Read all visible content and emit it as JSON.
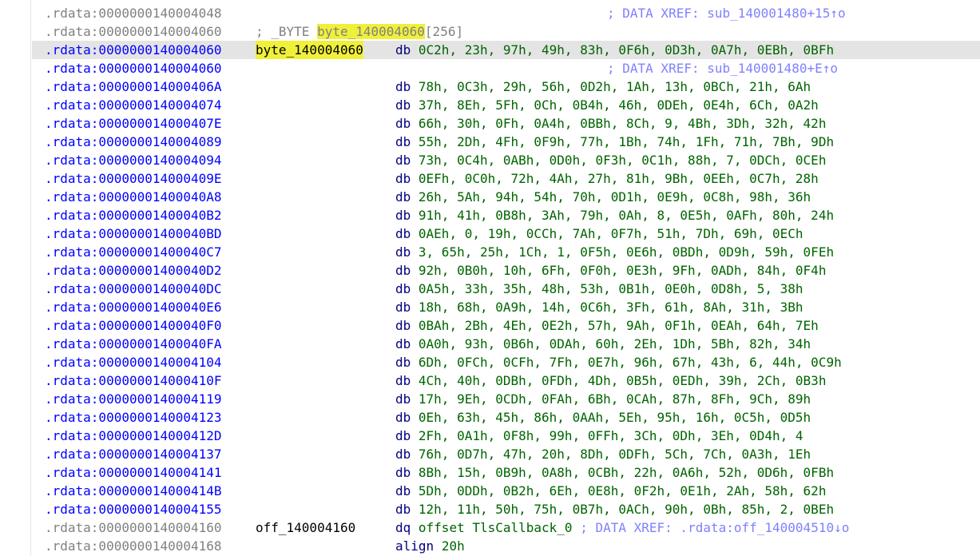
{
  "top": {
    "addr": ".rdata:0000000140004048",
    "comment": "; DATA XREF: sub_140001480+15↑o"
  },
  "declare": {
    "addr": ".rdata:0000000140004060",
    "prefix": "; _BYTE ",
    "name": "byte_140004060",
    "suffix": "[256]"
  },
  "selected": {
    "addr": ".rdata:0000000140004060",
    "label": "byte_140004060",
    "mnemonic": "db",
    "operands": "0C2h, 23h, 97h, 49h, 83h, 0F6h, 0D3h, 0A7h, 0EBh, 0BFh"
  },
  "xref2": {
    "addr": ".rdata:0000000140004060",
    "comment": "; DATA XREF: sub_140001480+E↑o"
  },
  "rows": [
    {
      "addr": ".rdata:000000014000406A",
      "mnemonic": "db",
      "operands": "78h, 0C3h, 29h, 56h, 0D2h, 1Ah, 13h, 0BCh, 21h, 6Ah"
    },
    {
      "addr": ".rdata:0000000140004074",
      "mnemonic": "db",
      "operands": "37h, 8Eh, 5Fh, 0Ch, 0B4h, 46h, 0DEh, 0E4h, 6Ch, 0A2h"
    },
    {
      "addr": ".rdata:000000014000407E",
      "mnemonic": "db",
      "operands": "66h, 30h, 0Fh, 0A4h, 0BBh, 8Ch, 9, 4Bh, 3Dh, 32h, 42h"
    },
    {
      "addr": ".rdata:0000000140004089",
      "mnemonic": "db",
      "operands": "55h, 2Dh, 4Fh, 0F9h, 77h, 1Bh, 74h, 1Fh, 71h, 7Bh, 9Dh"
    },
    {
      "addr": ".rdata:0000000140004094",
      "mnemonic": "db",
      "operands": "73h, 0C4h, 0ABh, 0D0h, 0F3h, 0C1h, 88h, 7, 0DCh, 0CEh"
    },
    {
      "addr": ".rdata:000000014000409E",
      "mnemonic": "db",
      "operands": "0EFh, 0C0h, 72h, 4Ah, 27h, 81h, 9Bh, 0EEh, 0C7h, 28h"
    },
    {
      "addr": ".rdata:00000001400040A8",
      "mnemonic": "db",
      "operands": "26h, 5Ah, 94h, 54h, 70h, 0D1h, 0E9h, 0C8h, 98h, 36h"
    },
    {
      "addr": ".rdata:00000001400040B2",
      "mnemonic": "db",
      "operands": "91h, 41h, 0B8h, 3Ah, 79h, 0Ah, 8, 0E5h, 0AFh, 80h, 24h"
    },
    {
      "addr": ".rdata:00000001400040BD",
      "mnemonic": "db",
      "operands": "0AEh, 0, 19h, 0CCh, 7Ah, 0F7h, 51h, 7Dh, 69h, 0ECh"
    },
    {
      "addr": ".rdata:00000001400040C7",
      "mnemonic": "db",
      "operands": "3, 65h, 25h, 1Ch, 1, 0F5h, 0E6h, 0BDh, 0D9h, 59h, 0FEh"
    },
    {
      "addr": ".rdata:00000001400040D2",
      "mnemonic": "db",
      "operands": "92h, 0B0h, 10h, 6Fh, 0F0h, 0E3h, 9Fh, 0ADh, 84h, 0F4h"
    },
    {
      "addr": ".rdata:00000001400040DC",
      "mnemonic": "db",
      "operands": "0A5h, 33h, 35h, 48h, 53h, 0B1h, 0E0h, 0D8h, 5, 38h"
    },
    {
      "addr": ".rdata:00000001400040E6",
      "mnemonic": "db",
      "operands": "18h, 68h, 0A9h, 14h, 0C6h, 3Fh, 61h, 8Ah, 31h, 3Bh"
    },
    {
      "addr": ".rdata:00000001400040F0",
      "mnemonic": "db",
      "operands": "0BAh, 2Bh, 4Eh, 0E2h, 57h, 9Ah, 0F1h, 0EAh, 64h, 7Eh"
    },
    {
      "addr": ".rdata:00000001400040FA",
      "mnemonic": "db",
      "operands": "0A0h, 93h, 0B6h, 0DAh, 60h, 2Eh, 1Dh, 5Bh, 82h, 34h"
    },
    {
      "addr": ".rdata:0000000140004104",
      "mnemonic": "db",
      "operands": "6Dh, 0FCh, 0CFh, 7Fh, 0E7h, 96h, 67h, 43h, 6, 44h, 0C9h"
    },
    {
      "addr": ".rdata:000000014000410F",
      "mnemonic": "db",
      "operands": "4Ch, 40h, 0DBh, 0FDh, 4Dh, 0B5h, 0EDh, 39h, 2Ch, 0B3h"
    },
    {
      "addr": ".rdata:0000000140004119",
      "mnemonic": "db",
      "operands": "17h, 9Eh, 0CDh, 0FAh, 6Bh, 0CAh, 87h, 8Fh, 9Ch, 89h"
    },
    {
      "addr": ".rdata:0000000140004123",
      "mnemonic": "db",
      "operands": "0Eh, 63h, 45h, 86h, 0AAh, 5Eh, 95h, 16h, 0C5h, 0D5h"
    },
    {
      "addr": ".rdata:000000014000412D",
      "mnemonic": "db",
      "operands": "2Fh, 0A1h, 0F8h, 99h, 0FFh, 3Ch, 0Dh, 3Eh, 0D4h, 4"
    },
    {
      "addr": ".rdata:0000000140004137",
      "mnemonic": "db",
      "operands": "76h, 0D7h, 47h, 20h, 8Dh, 0DFh, 5Ch, 7Ch, 0A3h, 1Eh"
    },
    {
      "addr": ".rdata:0000000140004141",
      "mnemonic": "db",
      "operands": "8Bh, 15h, 0B9h, 0A8h, 0CBh, 22h, 0A6h, 52h, 0D6h, 0FBh"
    },
    {
      "addr": ".rdata:000000014000414B",
      "mnemonic": "db",
      "operands": "5Dh, 0DDh, 0B2h, 6Eh, 0E8h, 0F2h, 0E1h, 2Ah, 58h, 62h"
    },
    {
      "addr": ".rdata:0000000140004155",
      "mnemonic": "db",
      "operands": "12h, 11h, 50h, 75h, 0B7h, 0ACh, 90h, 0Bh, 85h, 2, 0BEh"
    }
  ],
  "off": {
    "addr": ".rdata:0000000140004160",
    "label": "off_140004160",
    "mnemonic": "dq",
    "operands": "offset TlsCallback_0",
    "comment": "; DATA XREF: .rdata:off_140004510↓o"
  },
  "align": {
    "addr": ".rdata:0000000140004168",
    "mnemonic": "align",
    "operands": "20h"
  }
}
